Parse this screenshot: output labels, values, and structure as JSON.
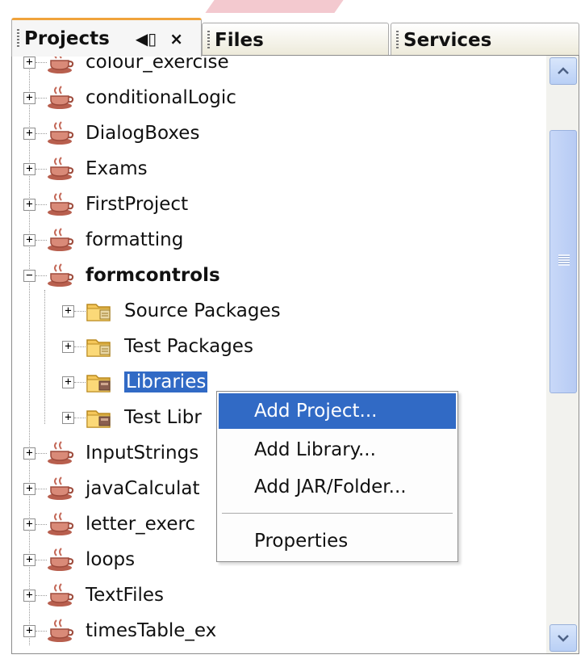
{
  "tabs": {
    "projects": "Projects",
    "files": "Files",
    "services": "Services"
  },
  "tree": {
    "projects": [
      {
        "label": "colour_exercise",
        "expanded": false
      },
      {
        "label": "conditionalLogic",
        "expanded": false
      },
      {
        "label": "DialogBoxes",
        "expanded": false
      },
      {
        "label": "Exams",
        "expanded": false
      },
      {
        "label": "FirstProject",
        "expanded": false
      },
      {
        "label": "formatting",
        "expanded": false
      },
      {
        "label": "formcontrols",
        "expanded": true,
        "children": [
          {
            "label": "Source Packages"
          },
          {
            "label": "Test Packages"
          },
          {
            "label": "Libraries",
            "selected": true
          },
          {
            "label": "Test Libr"
          }
        ]
      },
      {
        "label": "InputStrings",
        "expanded": false
      },
      {
        "label": "javaCalculat",
        "expanded": false
      },
      {
        "label": "letter_exerc",
        "expanded": false
      },
      {
        "label": "loops",
        "expanded": false
      },
      {
        "label": "TextFiles",
        "expanded": false
      },
      {
        "label": "timesTable_ex",
        "expanded": false
      }
    ]
  },
  "context_menu": {
    "items": [
      "Add Project...",
      "Add Library...",
      "Add JAR/Folder...",
      "Properties"
    ],
    "highlighted": "Add Project..."
  },
  "colors": {
    "selection": "#316ac5",
    "active_tab_accent": "#f0a33b"
  },
  "icons": {
    "project": "java-cup-icon",
    "folder": "package-folder-icon",
    "library": "library-folder-icon"
  }
}
